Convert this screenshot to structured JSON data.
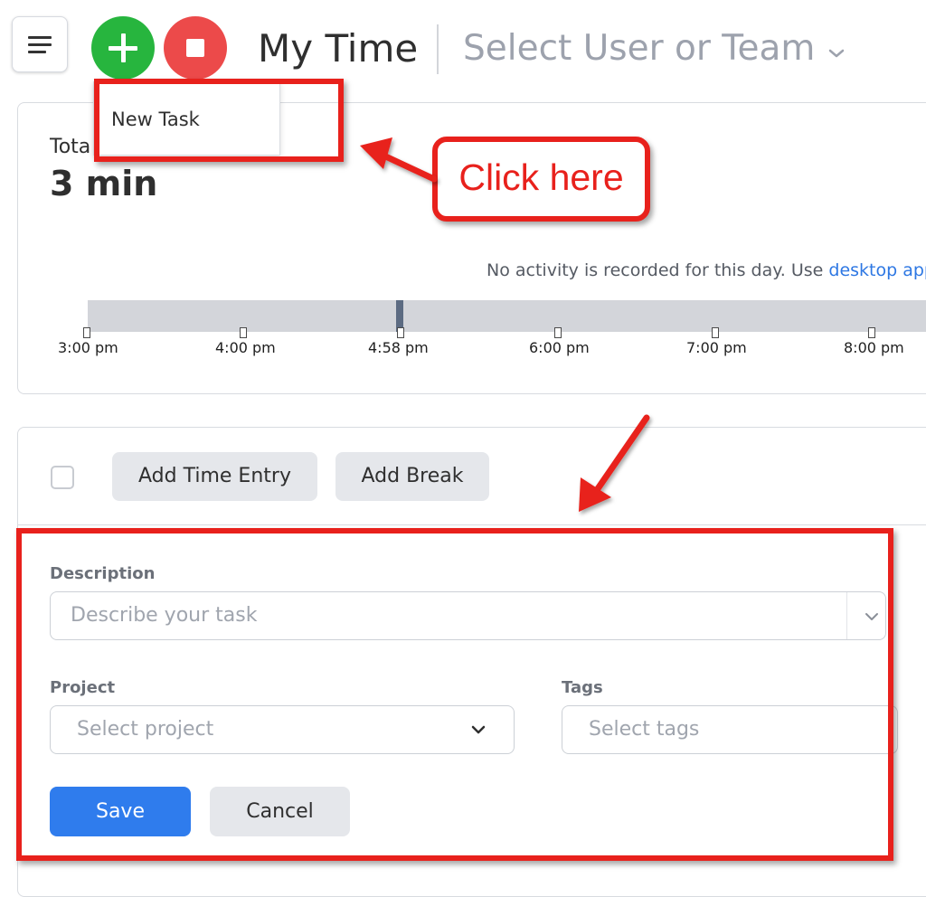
{
  "header": {
    "menu_icon": "hamburger-menu-icon",
    "add_icon": "plus-icon",
    "stop_icon": "stop-square-icon",
    "title": "My Time",
    "user_select": "Select User or Team"
  },
  "dropdown": {
    "items": [
      {
        "label": "New Task"
      }
    ]
  },
  "summary": {
    "total_label": "Tota",
    "total_value": "3 min",
    "activity_note": "No activity is recorded for this day. Use ",
    "activity_link": "desktop app",
    "timeline_ticks": [
      "3:00 pm",
      "4:00 pm",
      "4:58 pm",
      "6:00 pm",
      "7:00 pm",
      "8:00 pm"
    ]
  },
  "entries": {
    "add_time_entry": "Add Time Entry",
    "add_break": "Add Break"
  },
  "form": {
    "description_label": "Description",
    "description_placeholder": "Describe your task",
    "project_label": "Project",
    "project_placeholder": "Select project",
    "tags_label": "Tags",
    "tags_placeholder": "Select tags",
    "save": "Save",
    "cancel": "Cancel"
  },
  "annotation": {
    "callout": "Click here"
  },
  "colors": {
    "accent_blue": "#2f7ced",
    "add_green": "#27b53e",
    "stop_red": "#ec4a4a",
    "annotation_red": "#e8211c",
    "link_blue": "#2d77e3"
  }
}
